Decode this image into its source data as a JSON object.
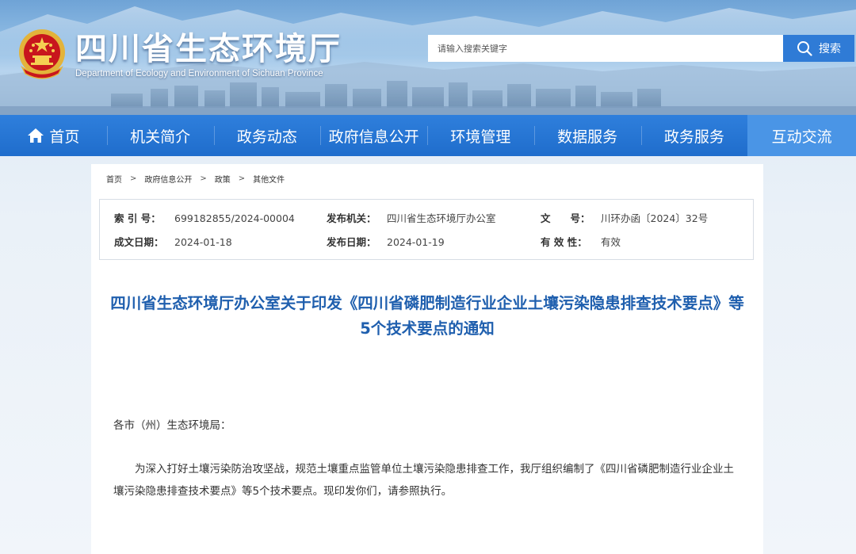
{
  "header": {
    "site_title": "四川省生态环境厅",
    "site_subtitle": "Department of Ecology and Environment of Sichuan Province",
    "search_placeholder": "请输入搜索关键字",
    "search_button": "搜索"
  },
  "nav": {
    "items": [
      {
        "label": "首页",
        "icon": "home-icon"
      },
      {
        "label": "机关简介"
      },
      {
        "label": "政务动态"
      },
      {
        "label": "政府信息公开"
      },
      {
        "label": "环境管理"
      },
      {
        "label": "数据服务"
      },
      {
        "label": "政务服务"
      },
      {
        "label": "互动交流",
        "active": true
      }
    ]
  },
  "breadcrumb": [
    "首页",
    "政府信息公开",
    "政策",
    "其他文件"
  ],
  "meta": {
    "index_label": "索 引 号：",
    "index_value": "699182855/2024-00004",
    "publisher_label": "发布机关：",
    "publisher_value": "四川省生态环境厅办公室",
    "docno_label": "文　　号：",
    "docno_value": "川环办函〔2024〕32号",
    "created_label": "成文日期：",
    "created_value": "2024-01-18",
    "published_label": "发布日期：",
    "published_value": "2024-01-19",
    "validity_label": "有 效 性：",
    "validity_value": "有效"
  },
  "article": {
    "title": "四川省生态环境厅办公室关于印发《四川省磷肥制造行业企业土壤污染隐患排查技术要点》等5个技术要点的通知",
    "greeting": "各市（州）生态环境局：",
    "paragraph": "为深入打好土壤污染防治攻坚战，规范土壤重点监管单位土壤污染隐患排查工作，我厅组织编制了《四川省磷肥制造行业企业土壤污染隐患排查技术要点》等5个技术要点。现印发你们，请参照执行。"
  },
  "colors": {
    "nav_bg": "#1f6dcc",
    "nav_active": "#4a95e6",
    "title_blue": "#1f5fae",
    "search_button": "#2f7bd6"
  }
}
